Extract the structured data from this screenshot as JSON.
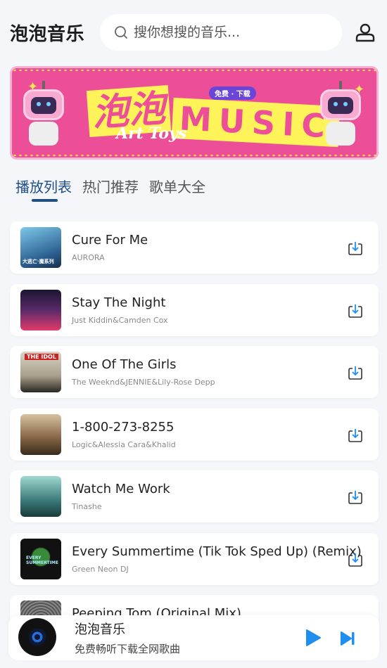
{
  "app": {
    "title": "泡泡音乐"
  },
  "search": {
    "placeholder": "搜你想搜的音乐..."
  },
  "banner": {
    "title_cn": "泡泡",
    "title_en": "MUSIC",
    "badge": "免费 · 下载",
    "subtitle": "Art Toys"
  },
  "tabs": [
    {
      "label": "播放列表",
      "active": true
    },
    {
      "label": "热门推荐",
      "active": false
    },
    {
      "label": "歌单大全",
      "active": false
    }
  ],
  "songs": [
    {
      "title": "Cure For Me",
      "artist": "AURORA",
      "cover_label": "大逃亡·魔系列",
      "cover_color": "#3a8fb5"
    },
    {
      "title": "Stay The Night",
      "artist": "Just Kiddin&Camden Cox",
      "cover_label": "",
      "cover_color": "#2a1e3a"
    },
    {
      "title": "One Of The Girls",
      "artist": "The Weeknd&JENNIE&Lily-Rose Depp",
      "cover_label": "THE IDOL",
      "cover_color": "#c9c2b4"
    },
    {
      "title": "1-800-273-8255",
      "artist": "Logic&Alessia Cara&Khalid",
      "cover_label": "",
      "cover_color": "#8a6a4a"
    },
    {
      "title": "Watch Me Work",
      "artist": "Tinashe",
      "cover_label": "",
      "cover_color": "#4a8a86"
    },
    {
      "title": "Every Summertime (Tik Tok Sped Up) (Remix)",
      "artist": "Green Neon DJ",
      "cover_label": "EVERY SUMMERTIME",
      "cover_color": "#111111"
    },
    {
      "title": "Peeping Tom (Original Mix)",
      "artist": "",
      "cover_label": "",
      "cover_color": "#555555"
    }
  ],
  "player": {
    "title": "泡泡音乐",
    "subtitle": "免费畅听下载全网歌曲"
  },
  "colors": {
    "accent": "#1e4f8a",
    "play": "#1e8ff0",
    "banner": "#ec4f98",
    "banner_yellow": "#fff35a"
  }
}
